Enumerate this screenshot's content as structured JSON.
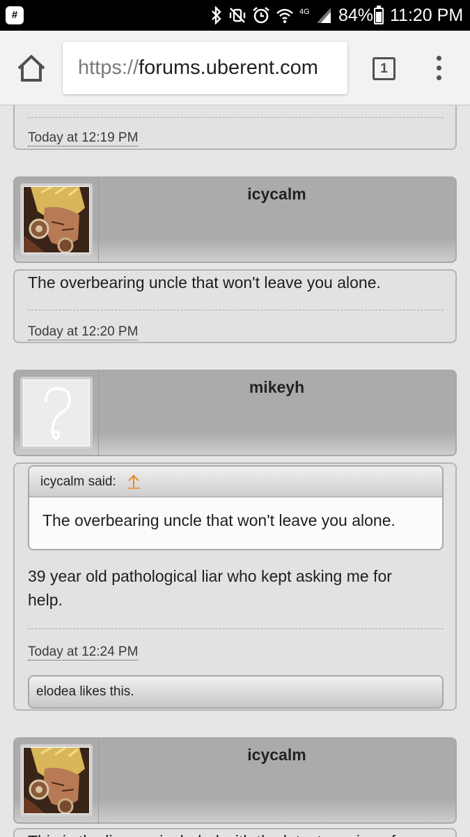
{
  "status_bar": {
    "battery_percent": "84%",
    "battery_level": 0.84,
    "time": "11:20 PM",
    "network_label": "4G",
    "icons": [
      "app-notification-icon",
      "bluetooth-icon",
      "vibrate-mute-icon",
      "alarm-icon",
      "wifi-icon",
      "network-4g-icon",
      "signal-icon",
      "battery-icon"
    ]
  },
  "browser": {
    "url_scheme": "https://",
    "url_host": "forums.uberent.com",
    "tab_count": "1"
  },
  "forum": {
    "posts": [
      {
        "date": "Today at 12:19 PM"
      },
      {
        "username": "icycalm",
        "message": "The overbearing uncle that won't leave you alone.",
        "date": "Today at 12:20 PM"
      },
      {
        "username": "mikeyh",
        "quote_author": "icycalm said:",
        "quote_text": "The overbearing uncle that won't leave you alone.",
        "message_line_1": "39 year old pathological liar who kept asking me for",
        "message_line_2": "help.",
        "date": "Today at 12:24 PM",
        "likes": "elodea likes this."
      },
      {
        "username": "icycalm",
        "message": "This is the line we included with the latest version of"
      }
    ]
  },
  "colors": {
    "link_orange": "#f08a1c",
    "header_gray": "#ababab",
    "box_gray": "#e2e2e2"
  }
}
